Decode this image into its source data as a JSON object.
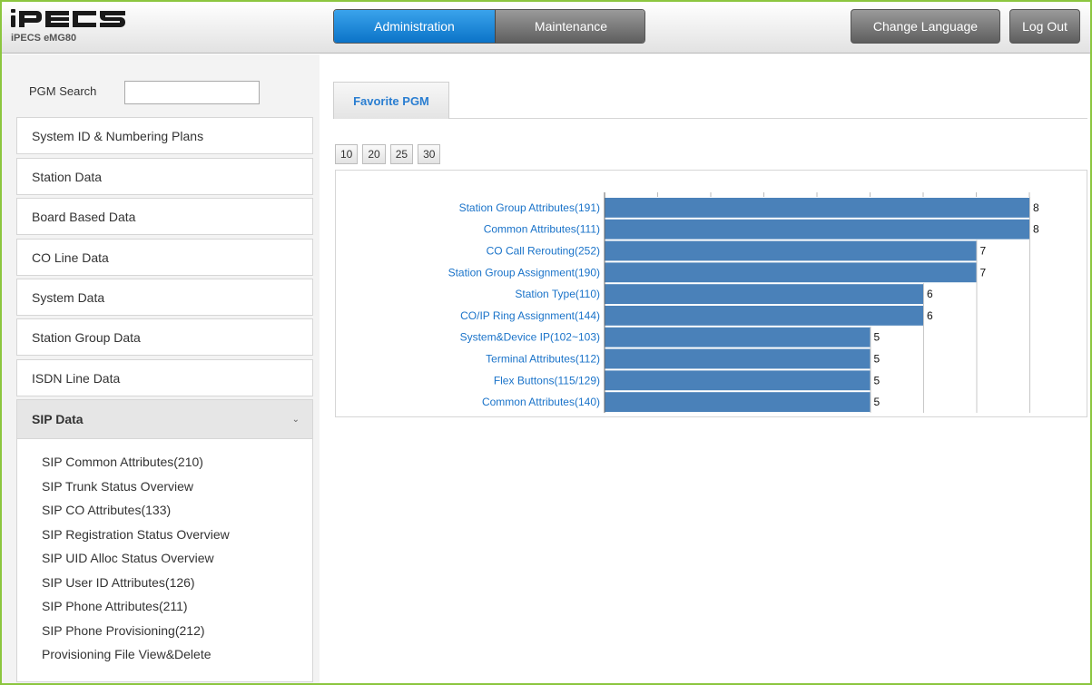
{
  "header": {
    "logo_text": "iPECS",
    "subtitle": "iPECS eMG80",
    "nav_tabs": [
      {
        "label": "Administration",
        "active": true
      },
      {
        "label": "Maintenance",
        "active": false
      }
    ],
    "change_language_label": "Change Language",
    "logout_label": "Log Out"
  },
  "sidebar": {
    "search_label": "PGM Search",
    "search_value": "",
    "items": [
      {
        "label": "System ID & Numbering Plans"
      },
      {
        "label": "Station Data"
      },
      {
        "label": "Board Based Data"
      },
      {
        "label": "CO Line Data"
      },
      {
        "label": "System Data"
      },
      {
        "label": "Station Group Data"
      },
      {
        "label": "ISDN Line Data"
      },
      {
        "label": "SIP Data",
        "expanded": true
      }
    ],
    "sip_submenu": [
      "SIP Common Attributes(210)",
      "SIP Trunk Status Overview",
      "SIP CO Attributes(133)",
      "SIP Registration Status Overview",
      "SIP UID Alloc Status Overview",
      "SIP User ID Attributes(126)",
      "SIP Phone Attributes(211)",
      "SIP Phone Provisioning(212)",
      "Provisioning File View&Delete"
    ]
  },
  "main": {
    "tab_label": "Favorite PGM",
    "page_sizes": [
      "10",
      "20",
      "25",
      "30"
    ]
  },
  "colors": {
    "bar": "#4a81b9",
    "link": "#1a73c9",
    "accent_green": "#8cc63f",
    "nav_active": "#0b73c8"
  },
  "chart_data": {
    "type": "bar",
    "orientation": "horizontal",
    "categories": [
      "Station Group Attributes(191)",
      "Common Attributes(111)",
      "CO Call Rerouting(252)",
      "Station Group Assignment(190)",
      "Station Type(110)",
      "CO/IP Ring Assignment(144)",
      "System&Device IP(102~103)",
      "Terminal Attributes(112)",
      "Flex Buttons(115/129)",
      "Common Attributes(140)"
    ],
    "values": [
      8,
      8,
      7,
      7,
      6,
      6,
      5,
      5,
      5,
      5
    ],
    "xlim": [
      0,
      8
    ],
    "grid": true
  }
}
